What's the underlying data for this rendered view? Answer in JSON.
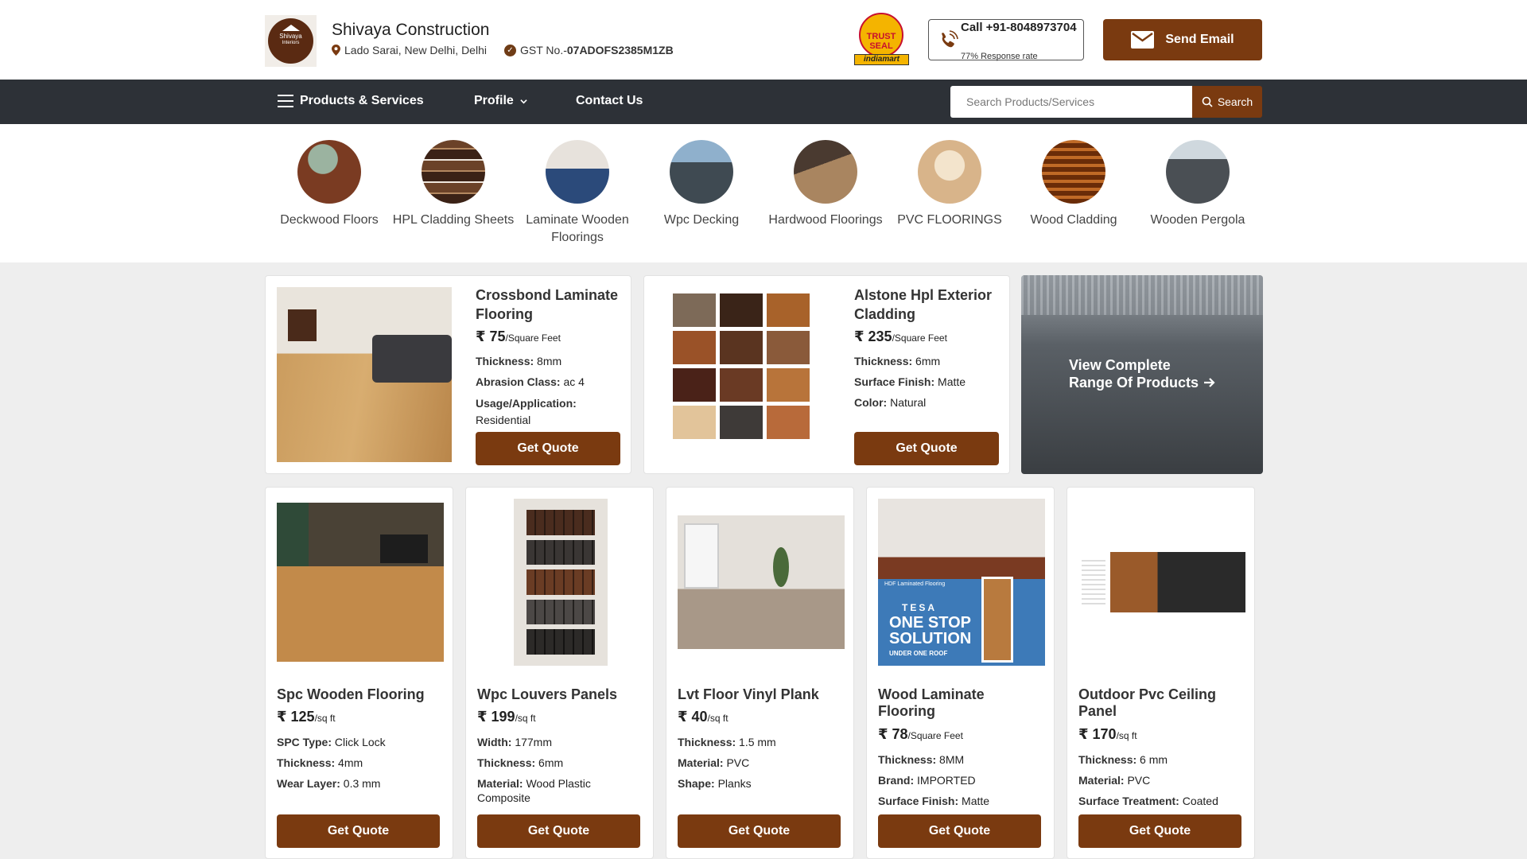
{
  "header": {
    "company": "Shivaya Construction",
    "logo_text_1": "Shivaya",
    "logo_text_2": "Interiors",
    "location": "Lado Sarai, New Delhi, Delhi",
    "gst_label": "GST No.-",
    "gst_no": "07ADOFS2385M1ZB",
    "trust_1": "TRUST",
    "trust_2": "SEAL",
    "trust_band": "indiamart",
    "call_number": "Call +91-8048973704",
    "response_rate": "77% Response rate",
    "email_label": "Send Email"
  },
  "nav": {
    "products": "Products & Services",
    "profile": "Profile",
    "contact": "Contact Us",
    "search_placeholder": "Search Products/Services",
    "search_label": "Search"
  },
  "categories": [
    {
      "label": "Deckwood Floors",
      "color": "#7a3b22"
    },
    {
      "label": "HPL Cladding Sheets",
      "color": "#5c3a26"
    },
    {
      "label": "Laminate Wooden Floorings",
      "color": "#c9c2bb"
    },
    {
      "label": "Wpc Decking",
      "color": "#3f4a52"
    },
    {
      "label": "Hardwood Floorings",
      "color": "#8a6a4a"
    },
    {
      "label": "PVC FLOORINGS",
      "color": "#d8b48a"
    },
    {
      "label": "Wood Cladding",
      "color": "#9a4a14"
    },
    {
      "label": "Wooden Pergola",
      "color": "#4a4f54"
    }
  ],
  "featured": [
    {
      "title": "Crossbond Laminate Flooring",
      "price": "₹ 75",
      "unit": "/Square Feet",
      "specs": [
        {
          "k": "Thickness:",
          "v": "8mm"
        },
        {
          "k": "Abrasion Class:",
          "v": "ac 4"
        },
        {
          "k": "Usage/Application:",
          "v": "Residential"
        }
      ],
      "button": "Get Quote"
    },
    {
      "title": "Alstone Hpl Exterior Cladding",
      "price": "₹ 235",
      "unit": "/Square Feet",
      "specs": [
        {
          "k": "Thickness:",
          "v": "6mm"
        },
        {
          "k": "Surface Finish:",
          "v": "Matte"
        },
        {
          "k": "Color:",
          "v": "Natural"
        }
      ],
      "button": "Get Quote"
    }
  ],
  "view_all": {
    "line1": "View Complete",
    "line2": "Range Of Products"
  },
  "products": [
    {
      "title": "Spc Wooden Flooring",
      "price": "₹ 125",
      "unit": "/sq ft",
      "specs": [
        {
          "k": "SPC Type:",
          "v": "Click Lock"
        },
        {
          "k": "Thickness:",
          "v": "4mm"
        },
        {
          "k": "Wear Layer:",
          "v": "0.3 mm"
        }
      ],
      "button": "Get Quote"
    },
    {
      "title": "Wpc Louvers Panels",
      "price": "₹ 199",
      "unit": "/sq ft",
      "specs": [
        {
          "k": "Width:",
          "v": "177mm"
        },
        {
          "k": "Thickness:",
          "v": "6mm"
        },
        {
          "k": "Material:",
          "v": "Wood Plastic Composite"
        }
      ],
      "button": "Get Quote"
    },
    {
      "title": "Lvt Floor Vinyl Plank",
      "price": "₹ 40",
      "unit": "/sq ft",
      "specs": [
        {
          "k": "Thickness:",
          "v": "1.5 mm"
        },
        {
          "k": "Material:",
          "v": "PVC"
        },
        {
          "k": "Shape:",
          "v": "Planks"
        }
      ],
      "button": "Get Quote"
    },
    {
      "title": "Wood Laminate Flooring",
      "price": "₹ 78",
      "unit": "/Square Feet",
      "specs": [
        {
          "k": "Thickness:",
          "v": "8MM"
        },
        {
          "k": "Brand:",
          "v": "IMPORTED"
        },
        {
          "k": "Surface Finish:",
          "v": "Matte"
        }
      ],
      "button": "Get Quote",
      "img_text_1": "HDF Laminated Flooring",
      "img_text_2": "TESA",
      "img_text_3": "ONE STOP",
      "img_text_4": "SOLUTION",
      "img_text_5": "UNDER ONE ROOF"
    },
    {
      "title": "Outdoor Pvc Ceiling Panel",
      "price": "₹ 170",
      "unit": "/sq ft",
      "specs": [
        {
          "k": "Thickness:",
          "v": "6 mm"
        },
        {
          "k": "Material:",
          "v": "PVC"
        },
        {
          "k": "Surface Treatment:",
          "v": "Coated"
        }
      ],
      "button": "Get Quote"
    }
  ],
  "colors": {
    "brand_brown": "#7a3a10",
    "nav_bg": "#2d3137",
    "page_bg": "#eeeeee"
  }
}
